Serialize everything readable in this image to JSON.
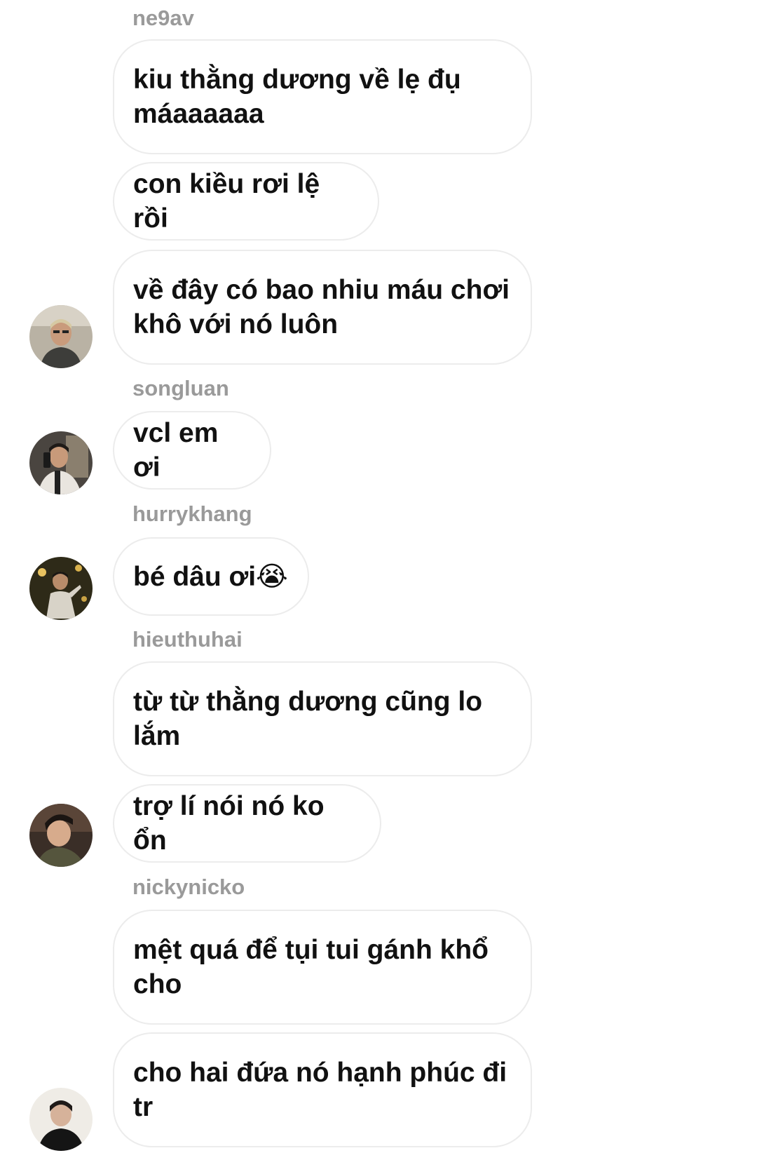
{
  "messages": [
    {
      "text": "kiu thằng dương về lẹ đụ máaaaaaa"
    },
    {
      "text": "con kiều rơi lệ rồi"
    },
    {
      "text": "về đây có bao nhiu máu chơi khô với nó luôn"
    },
    {
      "text": "vcl em ơi"
    },
    {
      "text": "bé dâu ơi😭"
    },
    {
      "text": "từ từ thằng dương cũng lo lắm"
    },
    {
      "text": "trợ lí nói nó ko ổn"
    },
    {
      "text": "mệt quá để tụi tui gánh khổ cho"
    },
    {
      "text": "cho hai đứa nó hạnh phúc đi tr"
    }
  ],
  "usernames": [
    "ne9av",
    "songluan",
    "hurrykhang",
    "hieuthuhai",
    "nickynicko"
  ],
  "avatars": [
    {
      "icon": "avatar-ne9av"
    },
    {
      "icon": "avatar-songluan"
    },
    {
      "icon": "avatar-hurrykhang"
    },
    {
      "icon": "avatar-hieuthuhai"
    },
    {
      "icon": "avatar-nickynicko"
    }
  ],
  "colors": {
    "background": "#ffffff",
    "bubble_border": "#ececec",
    "message_text": "#111111",
    "username_text": "#9a9a9a"
  }
}
